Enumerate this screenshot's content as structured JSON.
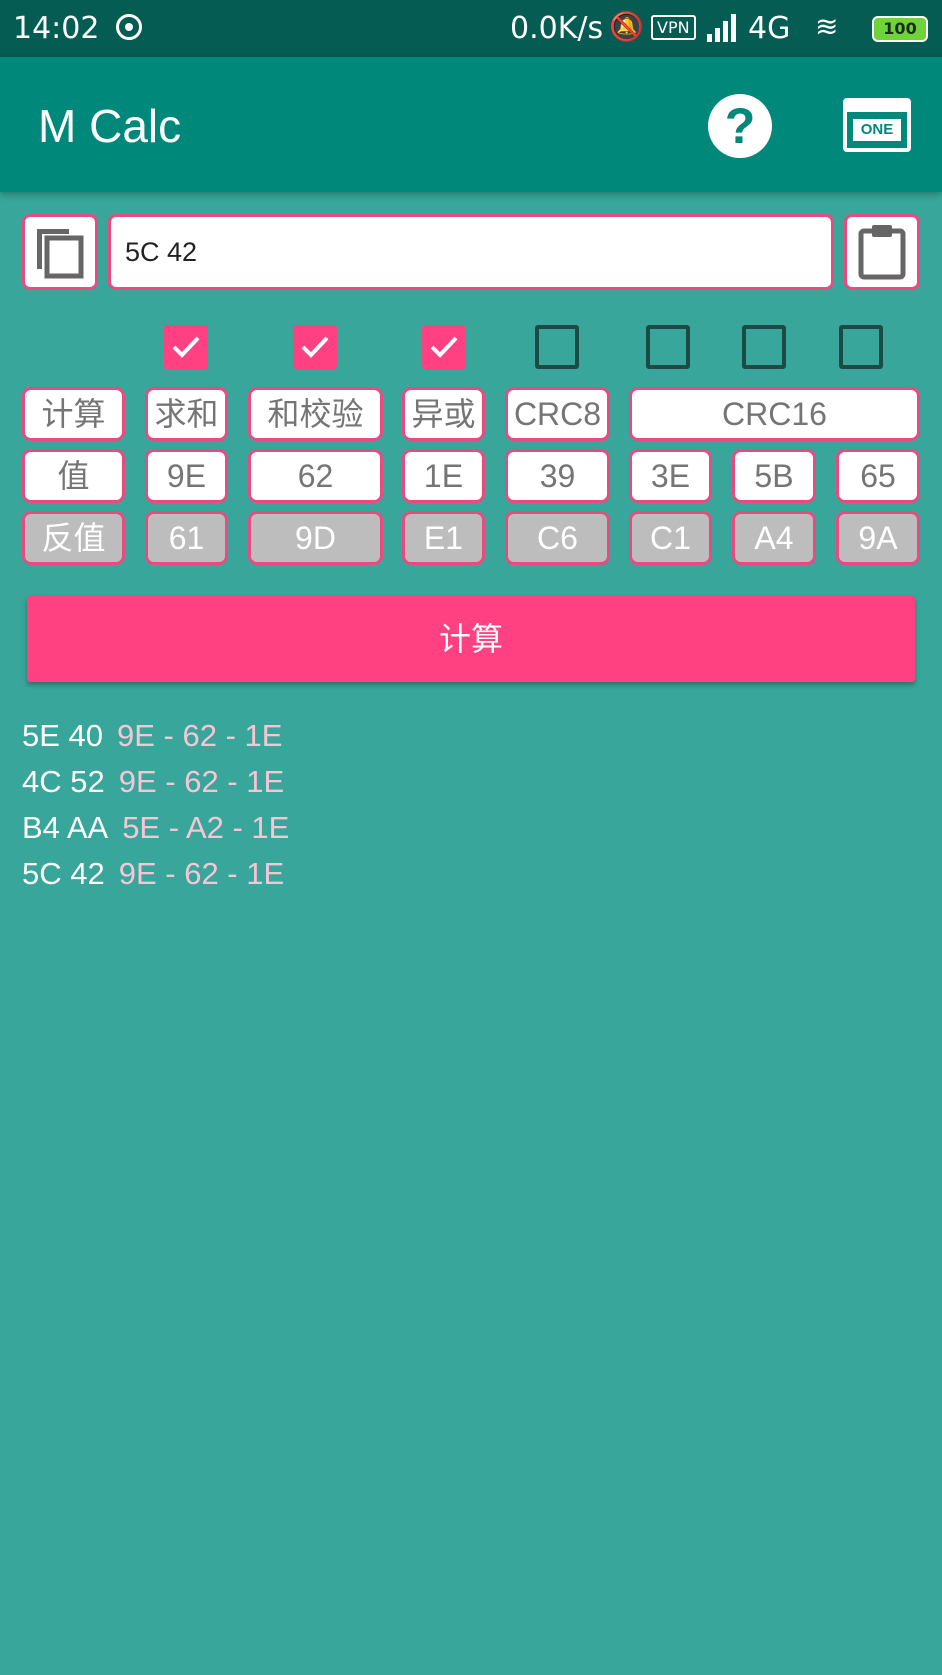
{
  "status_bar": {
    "time": "14:02",
    "net_speed": "0.0K/s",
    "vpn": "VPN",
    "network": "4G",
    "battery": "100"
  },
  "app_bar": {
    "title": "M Calc",
    "help_icon": "help-circle-icon",
    "one_label": "ONE"
  },
  "input": {
    "value": "5C 42"
  },
  "checkboxes": [
    true,
    true,
    true,
    false,
    false,
    false,
    false
  ],
  "header_row": {
    "calc": "计算",
    "sum": "求和",
    "checksum": "和校验",
    "xor": "异或",
    "crc8": "CRC8",
    "crc16": "CRC16"
  },
  "value_row": {
    "label": "值",
    "sum": "9E",
    "checksum": "62",
    "xor": "1E",
    "crc8": "39",
    "crc16_a": "3E",
    "crc16_b": "5B",
    "crc16_c": "65"
  },
  "inverse_row": {
    "label": "反值",
    "sum": "61",
    "checksum": "9D",
    "xor": "E1",
    "crc8": "C6",
    "crc16_a": "C1",
    "crc16_b": "A4",
    "crc16_c": "9A"
  },
  "calculate_button": "计算",
  "history": [
    {
      "input": "5E 40",
      "result": "9E - 62 - 1E"
    },
    {
      "input": "4C 52",
      "result": "9E - 62 - 1E"
    },
    {
      "input": "B4 AA",
      "result": "5E - A2 - 1E"
    },
    {
      "input": "5C 42",
      "result": "9E - 62 - 1E"
    }
  ]
}
